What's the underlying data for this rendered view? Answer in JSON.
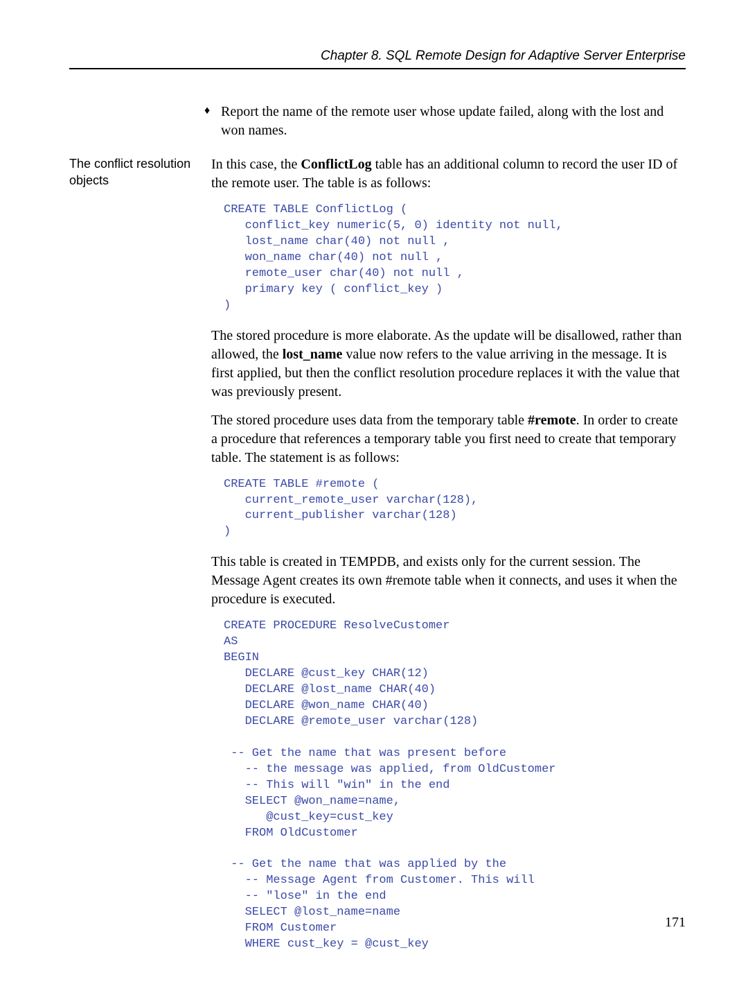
{
  "header": "Chapter 8.  SQL Remote Design for Adaptive Server Enterprise",
  "bullet": {
    "mark": "♦",
    "text": "Report the name of the remote user whose update failed, along with the lost and won names."
  },
  "sidebar_label": "The conflict resolution objects",
  "p1_a": "In this case, the ",
  "p1_b": "ConflictLog",
  "p1_c": " table has an additional column to record the user ID of the remote user. The table is as follows:",
  "code1": "CREATE TABLE ConflictLog (\n   conflict_key numeric(5, 0) identity not null,\n   lost_name char(40) not null ,\n   won_name char(40) not null ,\n   remote_user char(40) not null ,\n   primary key ( conflict_key )\n)",
  "p2_a": "The stored procedure is more elaborate. As the update will be disallowed, rather than allowed, the ",
  "p2_b": "lost_name",
  "p2_c": " value now refers to the value arriving in the message. It is first applied, but then the conflict resolution procedure replaces it with the value that was previously present.",
  "p3_a": "The stored procedure uses data from the temporary table ",
  "p3_b": "#remote",
  "p3_c": ". In order to create a procedure that references a temporary table you first need to create that temporary table. The statement is as follows:",
  "code2": "CREATE TABLE #remote (\n   current_remote_user varchar(128),\n   current_publisher varchar(128)\n)",
  "p4": "This table is created in TEMPDB, and exists only for the current session. The Message Agent creates its own #remote table when it connects, and uses it when the procedure is executed.",
  "code3": "CREATE PROCEDURE ResolveCustomer\nAS\nBEGIN\n   DECLARE @cust_key CHAR(12)\n   DECLARE @lost_name CHAR(40)\n   DECLARE @won_name CHAR(40)\n   DECLARE @remote_user varchar(128)\n\n -- Get the name that was present before\n   -- the message was applied, from OldCustomer\n   -- This will \"win\" in the end\n   SELECT @won_name=name,\n      @cust_key=cust_key\n   FROM OldCustomer\n\n -- Get the name that was applied by the\n   -- Message Agent from Customer. This will\n   -- \"lose\" in the end\n   SELECT @lost_name=name\n   FROM Customer\n   WHERE cust_key = @cust_key",
  "page_number": "171"
}
